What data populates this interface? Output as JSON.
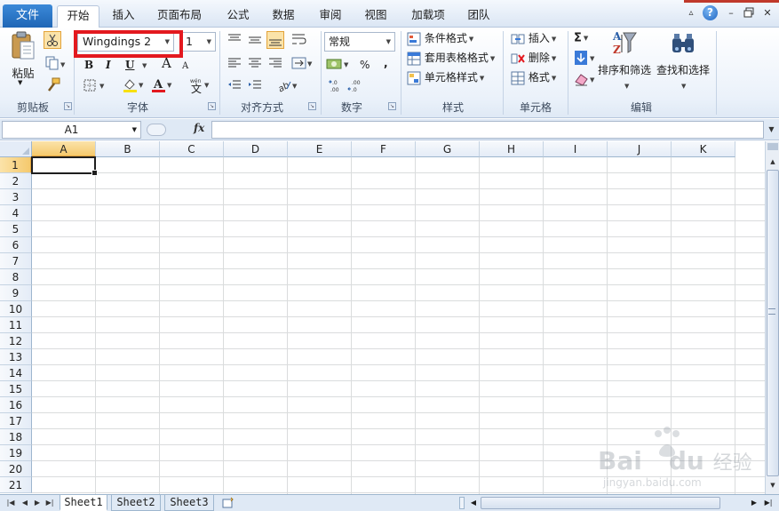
{
  "tabs": {
    "file": "文件",
    "items": [
      "开始",
      "插入",
      "页面布局",
      "公式",
      "数据",
      "审阅",
      "视图",
      "加载项",
      "团队"
    ],
    "active": "开始"
  },
  "window": {
    "help": "?",
    "minimize": "–",
    "restore": "▫",
    "close": "✕"
  },
  "ribbon": {
    "clipboard": {
      "label": "剪贴板",
      "paste": "粘贴"
    },
    "font": {
      "label": "字体",
      "name": "Wingdings 2",
      "size": "1",
      "bold": "B",
      "italic": "I",
      "underline": "U",
      "grow": "A",
      "shrink": "A",
      "phonetic": "wén",
      "phonetic_char": "文",
      "font_color": "A",
      "font_color_hex": "#e3191f",
      "fill_color_hex": "#f7e011"
    },
    "alignment": {
      "label": "对齐方式"
    },
    "number": {
      "label": "数字",
      "format": "常规",
      "percent": "%",
      "comma": ","
    },
    "styles": {
      "label": "样式",
      "conditional": "条件格式",
      "table": "套用表格格式",
      "cell": "单元格样式"
    },
    "cells": {
      "label": "单元格",
      "insert": "插入",
      "delete": "删除",
      "format": "格式"
    },
    "editing": {
      "label": "编辑",
      "sigma": "Σ",
      "sort": "排序和筛选",
      "find": "查找和选择"
    }
  },
  "formula_bar": {
    "name_box": "A1",
    "fx": "fx",
    "formula": ""
  },
  "columns": [
    "A",
    "B",
    "C",
    "D",
    "E",
    "F",
    "G",
    "H",
    "I",
    "J",
    "K"
  ],
  "rows": [
    "1",
    "2",
    "3",
    "4",
    "5",
    "6",
    "7",
    "8",
    "9",
    "10",
    "11",
    "12",
    "13",
    "14",
    "15",
    "16",
    "17",
    "18",
    "19",
    "20",
    "21"
  ],
  "selection": {
    "column": "A",
    "row": "1"
  },
  "sheets": [
    "Sheet1",
    "Sheet2",
    "Sheet3"
  ],
  "active_sheet": "Sheet1",
  "watermark": {
    "brand": "Bai",
    "brand2": "du",
    "suffix": "经验",
    "url": "jingyan.baidu.com"
  },
  "colors": {
    "file_tab": "#2a72c4",
    "highlight_box": "#e3191f",
    "selected_header": "#f5c96d"
  }
}
